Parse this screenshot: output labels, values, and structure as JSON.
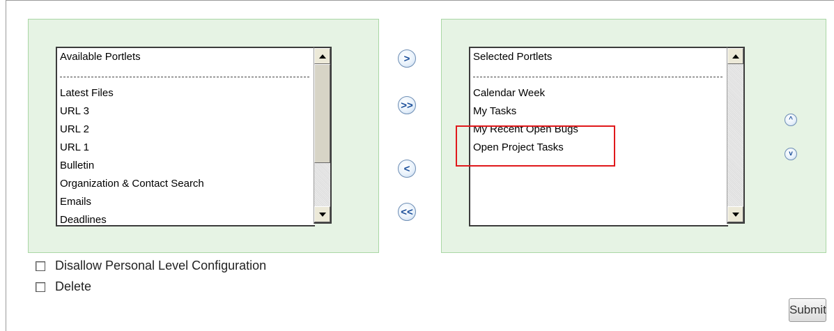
{
  "available": {
    "header": "Available Portlets",
    "items": [
      "Latest Files",
      "URL 3",
      "URL 2",
      "URL 1",
      "Bulletin",
      "Organization & Contact Search",
      "Emails",
      "Deadlines"
    ]
  },
  "selected": {
    "header": "Selected Portlets",
    "items": [
      "Calendar Week",
      "My Tasks",
      "My Recent Open Bugs",
      "Open Project Tasks"
    ]
  },
  "transfer_buttons": {
    "add": ">",
    "add_all": ">>",
    "remove": "<",
    "remove_all": "<<"
  },
  "order_buttons": {
    "up": "^",
    "down": "v"
  },
  "options": {
    "disallow_label": "Disallow Personal Level Configuration",
    "disallow_checked": false,
    "delete_label": "Delete",
    "delete_checked": false
  },
  "submit_label": "Submit",
  "colors": {
    "panel_bg": "#e6f3e4",
    "panel_border": "#a9d7a4",
    "highlight": "#e0181b",
    "button_blue": "#1b4f9a"
  }
}
